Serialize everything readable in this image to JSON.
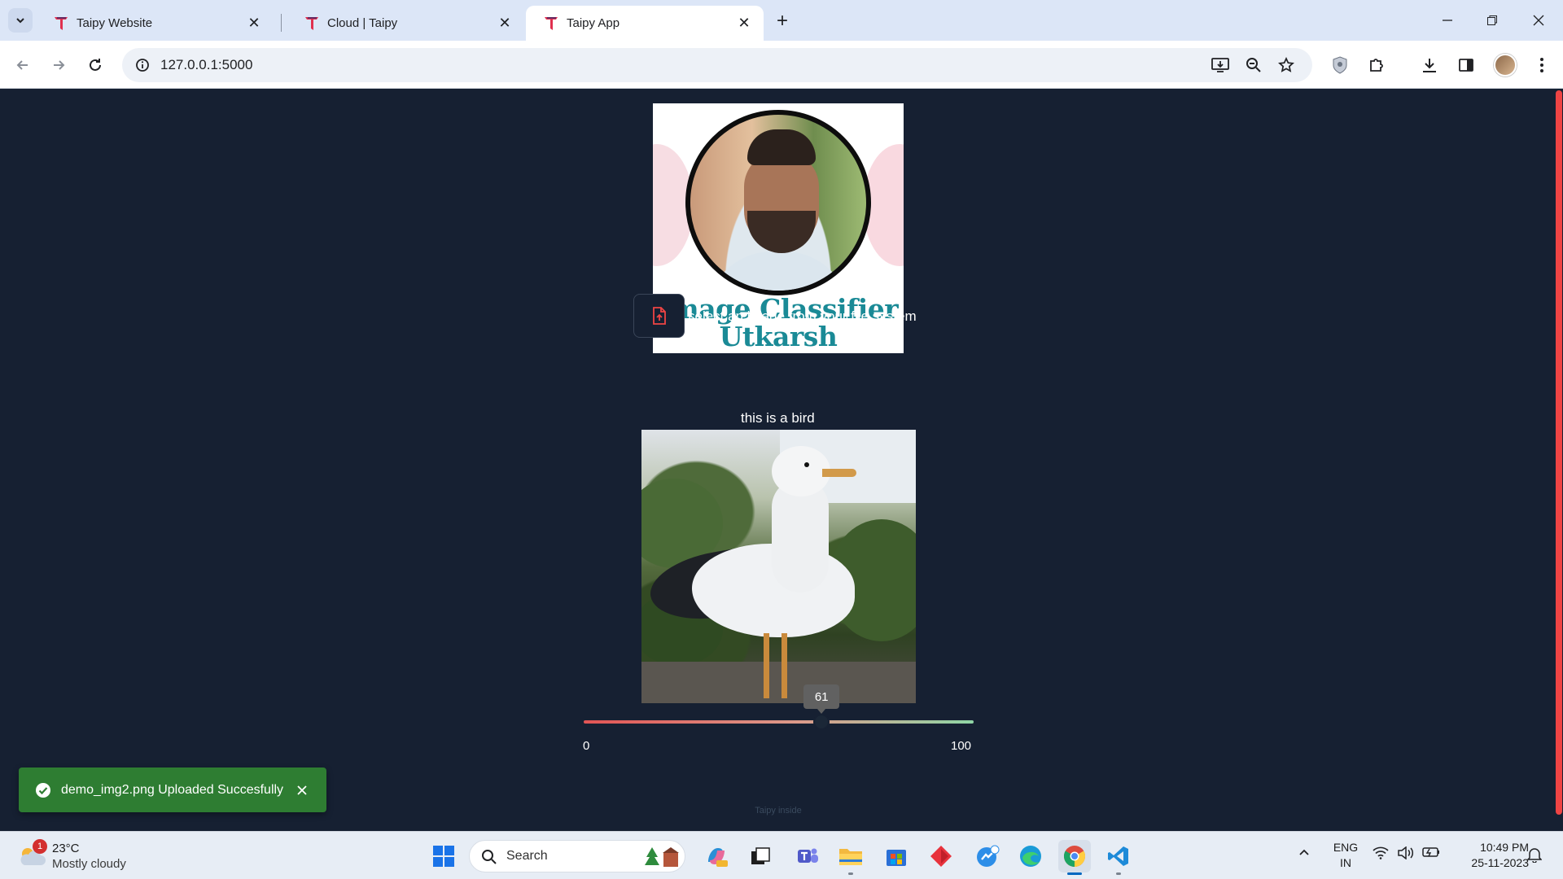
{
  "browser": {
    "tabs": [
      {
        "title": "Taipy Website",
        "active": false
      },
      {
        "title": "Cloud | Taipy",
        "active": false
      },
      {
        "title": "Taipy App",
        "active": true
      }
    ],
    "url": "127.0.0.1:5000"
  },
  "app": {
    "banner": {
      "line1": "Image Classifier",
      "line2": "Utkarsh Gaikwad"
    },
    "upload": {
      "label": "select an image from your file system"
    },
    "prediction": "this is a bird",
    "slider": {
      "value": 61,
      "value_label": "61",
      "min": "0",
      "max": "100"
    },
    "toast": {
      "message": "demo_img2.png Uploaded Succesfully"
    },
    "footer": "Taipy inside"
  },
  "taskbar": {
    "weather": {
      "badge": "1",
      "temperature": "23°C",
      "condition": "Mostly cloudy"
    },
    "search_placeholder": "Search",
    "language": [
      "ENG",
      "IN"
    ],
    "time": "10:49 PM",
    "date": "25-11-2023"
  },
  "colors": {
    "page_bg": "#162032",
    "accent_red": "#ef4444",
    "banner_title": "#1a8a96",
    "toast_green": "#2e7d32"
  }
}
